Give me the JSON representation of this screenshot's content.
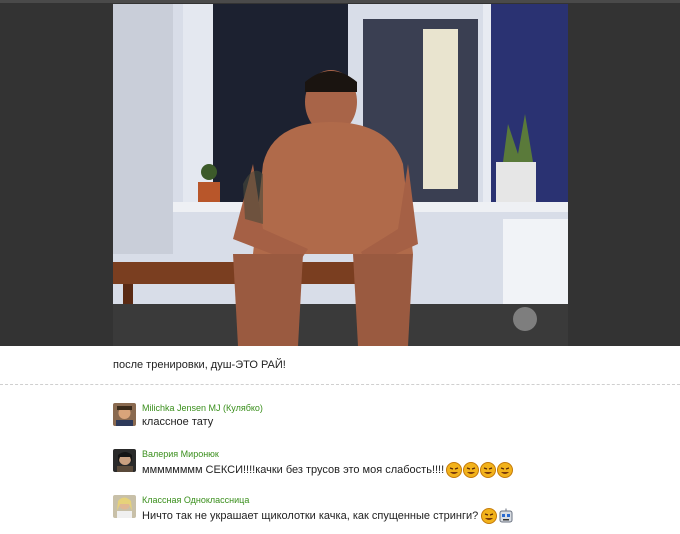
{
  "post": {
    "caption": "после тренировки, душ-ЭТО РАЙ!"
  },
  "comments": [
    {
      "author": "Milichka Jensen MJ (Кулябко)",
      "text": "классное тату",
      "smileys": []
    },
    {
      "author": "Валерия Миронюк",
      "text": "мммммммм СЕКСИ!!!!качки без трусов это моя слабость!!!!",
      "smileys": [
        "laughing-smiley",
        "laughing-smiley",
        "laughing-smiley",
        "laughing-smiley"
      ]
    },
    {
      "author": "Классная Одноклассница",
      "text": "Ничто так не украшает щиколотки качка, как спущенные стринги?",
      "smileys": [
        "laughing-smiley",
        "robot-smiley"
      ]
    }
  ]
}
